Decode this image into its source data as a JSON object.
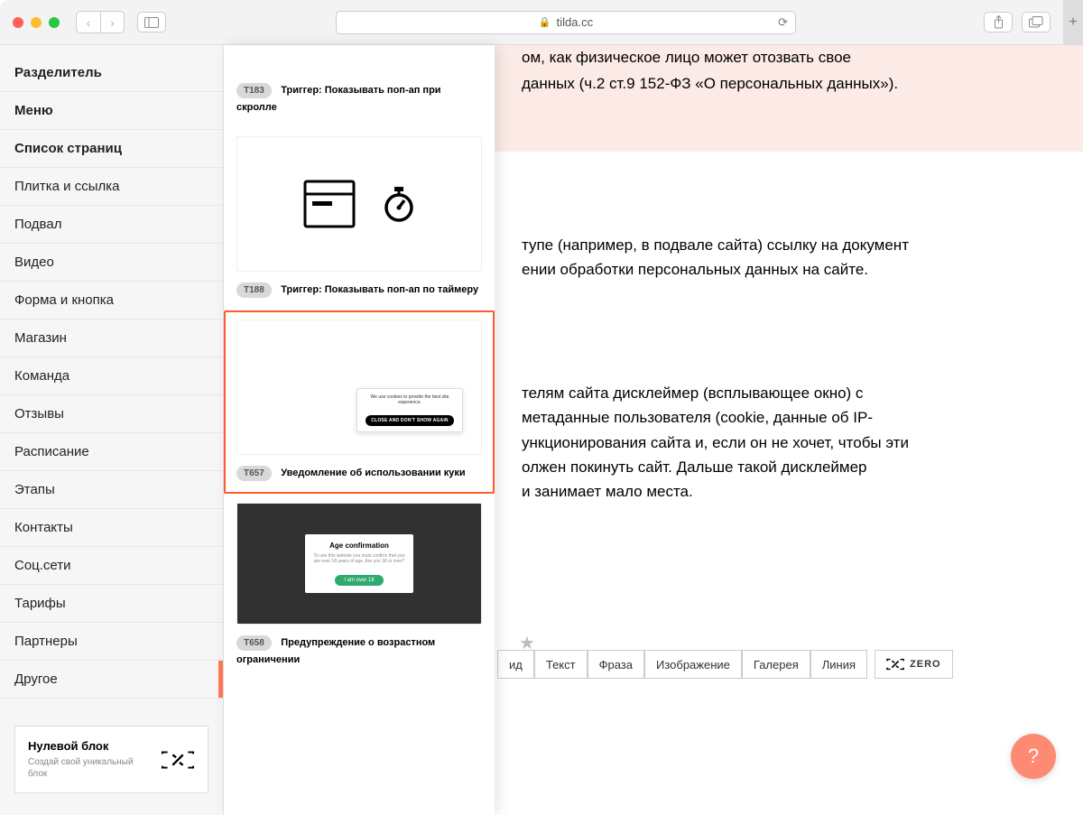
{
  "browser": {
    "domain": "tilda.cc"
  },
  "sidebar": {
    "items": [
      {
        "label": "Разделитель",
        "bold": true
      },
      {
        "label": "Меню",
        "bold": true
      },
      {
        "label": "Список страниц",
        "bold": true
      },
      {
        "label": "Плитка и ссылка"
      },
      {
        "label": "Подвал"
      },
      {
        "label": "Видео"
      },
      {
        "label": "Форма и кнопка"
      },
      {
        "label": "Магазин"
      },
      {
        "label": "Команда"
      },
      {
        "label": "Отзывы"
      },
      {
        "label": "Расписание"
      },
      {
        "label": "Этапы"
      },
      {
        "label": "Контакты"
      },
      {
        "label": "Соц.сети"
      },
      {
        "label": "Тарифы"
      },
      {
        "label": "Партнеры"
      },
      {
        "label": "Другое",
        "active": true
      }
    ],
    "zero": {
      "title": "Нулевой блок",
      "sub": "Создай свой уникальный блок"
    }
  },
  "blocks": [
    {
      "code": "T183",
      "label": "Триггер: Показывать поп-ап при скролле"
    },
    {
      "code": "T188",
      "label": "Триггер: Показывать поп-ап по таймеру"
    },
    {
      "code": "T657",
      "label": "Уведомление об использовании куки",
      "selected": true,
      "cookie": {
        "text": "We use cookies to provide the best site experience.",
        "button": "CLOSE AND DON'T SHOW AGAIN"
      }
    },
    {
      "code": "T658",
      "label": "Предупреждение о возрастном ограничении",
      "age": {
        "heading": "Age confirmation",
        "text": "To use this website you must confirm that you are over 18 years of age. Are you 18 or over?",
        "button": "I am over 18"
      }
    }
  ],
  "article": {
    "p1a": "ом, как физическое лицо может отозвать свое",
    "p1b": "данных (ч.2 ст.9 152-ФЗ «О персональных данных»).",
    "p2a": "тупе (например, в подвале сайта) ссылку на документ",
    "p2b": "ении обработки персональных данных на сайте.",
    "p3a": "телям сайта дисклеймер (всплывающее окно) с",
    "p3b": "метаданные пользователя (cookie, данные об IP-",
    "p3c": "ункционирования сайта и, если он не хочет, чтобы эти",
    "p3d": "олжен покинуть сайт. Дальше такой дисклеймер",
    "p3e": " и занимает мало места."
  },
  "toolbar": {
    "items": [
      "ид",
      "Текст",
      "Фраза",
      "Изображение",
      "Галерея",
      "Линия"
    ],
    "zero": "ZERO"
  },
  "help": "?"
}
